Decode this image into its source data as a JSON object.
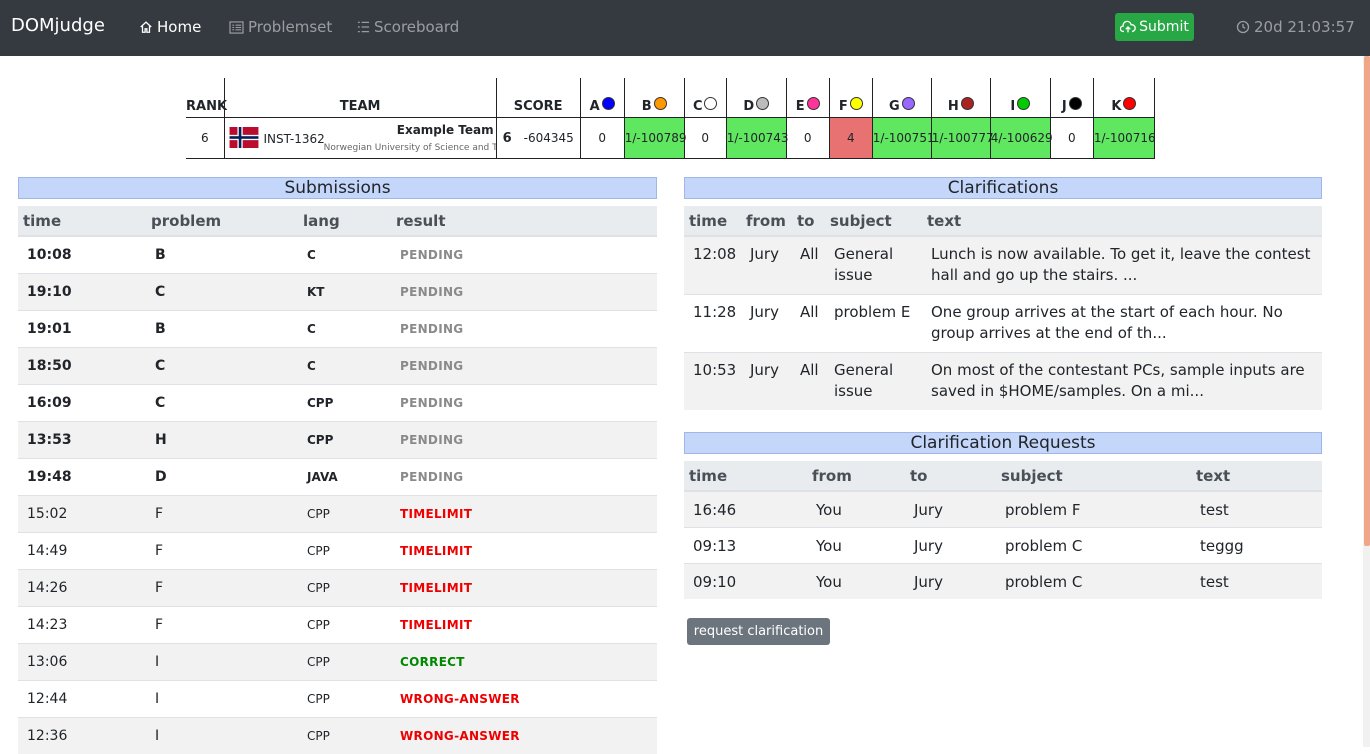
{
  "navbar": {
    "brand": "DOMjudge",
    "items": [
      {
        "label": "Home",
        "icon": "home-icon"
      },
      {
        "label": "Problemset",
        "icon": "list-alt-icon"
      },
      {
        "label": "Scoreboard",
        "icon": "list-ol-icon"
      }
    ],
    "submit_label": "Submit",
    "clock": "20d 21:03:57"
  },
  "scoreboard": {
    "headers": {
      "rank": "RANK",
      "team": "TEAM",
      "score": "SCORE"
    },
    "problems": [
      {
        "label": "A",
        "color": "#0000ff"
      },
      {
        "label": "B",
        "color": "#ff9900"
      },
      {
        "label": "C",
        "color": "#ffffff"
      },
      {
        "label": "D",
        "color": "#bbbbbb"
      },
      {
        "label": "E",
        "color": "#ff3399"
      },
      {
        "label": "F",
        "color": "#ffff00"
      },
      {
        "label": "G",
        "color": "#9966ff"
      },
      {
        "label": "H",
        "color": "#aa2222"
      },
      {
        "label": "I",
        "color": "#00cc00"
      },
      {
        "label": "J",
        "color": "#000000"
      },
      {
        "label": "K",
        "color": "#ff0000"
      }
    ],
    "row": {
      "rank": "6",
      "affiliation": "INST-1362",
      "team_name": "Example Team",
      "university": "Norwegian University of Science and Technology",
      "solved": "6",
      "penalty": "-604345",
      "cells": [
        {
          "value": "0",
          "state": "none"
        },
        {
          "value": "1/-100789",
          "state": "solved"
        },
        {
          "value": "0",
          "state": "none"
        },
        {
          "value": "1/-100743",
          "state": "solved"
        },
        {
          "value": "0",
          "state": "none"
        },
        {
          "value": "4",
          "state": "tried"
        },
        {
          "value": "1/-100751",
          "state": "solved"
        },
        {
          "value": "1/-100777",
          "state": "solved"
        },
        {
          "value": "4/-100629",
          "state": "solved"
        },
        {
          "value": "0",
          "state": "none"
        },
        {
          "value": "1/-100716",
          "state": "solved"
        }
      ]
    }
  },
  "submissions": {
    "title": "Submissions",
    "columns": {
      "time": "time",
      "problem": "problem",
      "lang": "lang",
      "result": "result"
    },
    "rows": [
      {
        "time": "10:08",
        "problem": "B",
        "lang": "C",
        "result": "PENDING",
        "status": "pending",
        "unseen": true
      },
      {
        "time": "19:10",
        "problem": "C",
        "lang": "KT",
        "result": "PENDING",
        "status": "pending",
        "unseen": true
      },
      {
        "time": "19:01",
        "problem": "B",
        "lang": "C",
        "result": "PENDING",
        "status": "pending",
        "unseen": true
      },
      {
        "time": "18:50",
        "problem": "C",
        "lang": "C",
        "result": "PENDING",
        "status": "pending",
        "unseen": true
      },
      {
        "time": "16:09",
        "problem": "C",
        "lang": "CPP",
        "result": "PENDING",
        "status": "pending",
        "unseen": true
      },
      {
        "time": "13:53",
        "problem": "H",
        "lang": "CPP",
        "result": "PENDING",
        "status": "pending",
        "unseen": true
      },
      {
        "time": "19:48",
        "problem": "D",
        "lang": "JAVA",
        "result": "PENDING",
        "status": "pending",
        "unseen": true
      },
      {
        "time": "15:02",
        "problem": "F",
        "lang": "CPP",
        "result": "TIMELIMIT",
        "status": "wrong",
        "unseen": false
      },
      {
        "time": "14:49",
        "problem": "F",
        "lang": "CPP",
        "result": "TIMELIMIT",
        "status": "wrong",
        "unseen": false
      },
      {
        "time": "14:26",
        "problem": "F",
        "lang": "CPP",
        "result": "TIMELIMIT",
        "status": "wrong",
        "unseen": false
      },
      {
        "time": "14:23",
        "problem": "F",
        "lang": "CPP",
        "result": "TIMELIMIT",
        "status": "wrong",
        "unseen": false
      },
      {
        "time": "13:06",
        "problem": "I",
        "lang": "CPP",
        "result": "CORRECT",
        "status": "correct",
        "unseen": false
      },
      {
        "time": "12:44",
        "problem": "I",
        "lang": "CPP",
        "result": "WRONG-ANSWER",
        "status": "wrong",
        "unseen": false
      },
      {
        "time": "12:36",
        "problem": "I",
        "lang": "CPP",
        "result": "WRONG-ANSWER",
        "status": "wrong",
        "unseen": false
      }
    ],
    "status_colors": {
      "pending": "#8a8a8a",
      "wrong": "#ee0000",
      "correct": "#008800"
    }
  },
  "clarifications": {
    "title": "Clarifications",
    "columns": {
      "time": "time",
      "from": "from",
      "to": "to",
      "subject": "subject",
      "text": "text"
    },
    "rows": [
      {
        "time": "12:08",
        "from": "Jury",
        "to": "All",
        "subject": "General issue",
        "text": "Lunch is now available. To get it, leave the contest hall and go up the stairs. ..."
      },
      {
        "time": "11:28",
        "from": "Jury",
        "to": "All",
        "subject": "problem E",
        "text": "One group arrives at the start of each hour. No group arrives at the end of th..."
      },
      {
        "time": "10:53",
        "from": "Jury",
        "to": "All",
        "subject": "General issue",
        "text": "On most of the contestant PCs, sample inputs are saved in $HOME/samples. On a mi..."
      }
    ]
  },
  "clarification_requests": {
    "title": "Clarification Requests",
    "columns": {
      "time": "time",
      "from": "from",
      "to": "to",
      "subject": "subject",
      "text": "text"
    },
    "rows": [
      {
        "time": "16:46",
        "from": "You",
        "to": "Jury",
        "subject": "problem F",
        "text": "test"
      },
      {
        "time": "09:13",
        "from": "You",
        "to": "Jury",
        "subject": "problem C",
        "text": "teggg"
      },
      {
        "time": "09:10",
        "from": "You",
        "to": "Jury",
        "subject": "problem C",
        "text": "test"
      }
    ],
    "button_label": "request clarification"
  }
}
